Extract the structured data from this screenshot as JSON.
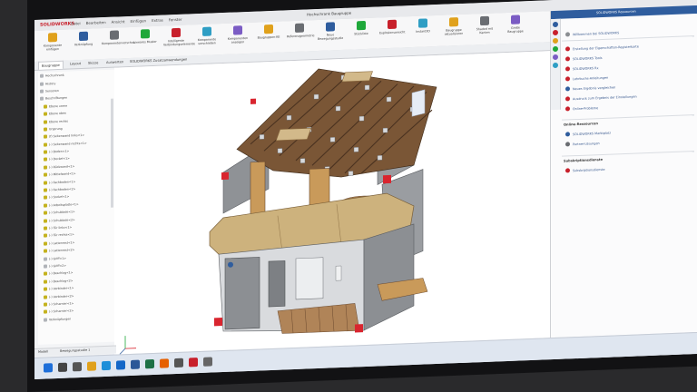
{
  "app": {
    "name": "SOLIDWORKS"
  },
  "menu": [
    "Datei",
    "Bearbeiten",
    "Ansicht",
    "Einfügen",
    "Extras",
    "Fenster"
  ],
  "doc_title": "Hochschrank Baugruppe",
  "ribbon_buttons": [
    "Komponente einfügen",
    "Verknüpfung",
    "Komponentenvorschau",
    "Lineares Muster",
    "Intelligente Verbindungselemente",
    "Komponente verschieben",
    "Komponenten anzeigen",
    "Baugruppen-KE",
    "Referenzgeometrie",
    "Neue Bewegungsstudie",
    "Stückliste",
    "Explosionsansicht",
    "Instant3D",
    "Baugruppe aktualisieren",
    "Shaded mit Kanten",
    "Große Baugruppe"
  ],
  "tabs": [
    "Baugruppe",
    "Layout",
    "Skizze",
    "Auswerten",
    "SOLIDWORKS Zusatzanwendungen"
  ],
  "active_tab_index": 0,
  "tree": {
    "rows": [
      {
        "label": "Hochschrank",
        "grey": true
      },
      {
        "label": "History",
        "grey": true
      },
      {
        "label": "Sensoren",
        "grey": true
      },
      {
        "label": "Beschriftungen",
        "grey": true
      },
      {
        "label": "Ebene vorne",
        "grey": false
      },
      {
        "label": "Ebene oben",
        "grey": false
      },
      {
        "label": "Ebene rechts",
        "grey": false
      },
      {
        "label": "Ursprung",
        "grey": false
      },
      {
        "label": "(f) Seitenwand links<1>",
        "grey": false
      },
      {
        "label": "(-) Seitenwand rechts<1>",
        "grey": false
      },
      {
        "label": "(-) Boden<1>",
        "grey": false
      },
      {
        "label": "(-) Deckel<1>",
        "grey": false
      },
      {
        "label": "(-) Rückwand<1>",
        "grey": false
      },
      {
        "label": "(-) Mittelwand<1>",
        "grey": false
      },
      {
        "label": "(-) Fachboden<1>",
        "grey": false
      },
      {
        "label": "(-) Fachboden<2>",
        "grey": false
      },
      {
        "label": "(-) Sockel<1>",
        "grey": false
      },
      {
        "label": "(-) Arbeitsplatte<1>",
        "grey": false
      },
      {
        "label": "(-) Schublade<1>",
        "grey": false
      },
      {
        "label": "(-) Schublade<2>",
        "grey": false
      },
      {
        "label": "(-) Tür links<1>",
        "grey": false
      },
      {
        "label": "(-) Tür rechts<1>",
        "grey": false
      },
      {
        "label": "(-) Lattenrost<1>",
        "grey": false
      },
      {
        "label": "(-) Lattenrost<2>",
        "grey": false
      },
      {
        "label": "(-) Griff<1>",
        "grey": true
      },
      {
        "label": "(-) Griff<2>",
        "grey": true
      },
      {
        "label": "(-) Beschlag<1>",
        "grey": false
      },
      {
        "label": "(-) Beschlag<2>",
        "grey": false
      },
      {
        "label": "(-) Verbinder<1>",
        "grey": false
      },
      {
        "label": "(-) Verbinder<2>",
        "grey": false
      },
      {
        "label": "(-) Scharnier<1>",
        "grey": false
      },
      {
        "label": "(-) Scharnier<2>",
        "grey": false
      },
      {
        "label": "Verknüpfungen",
        "grey": true
      }
    ]
  },
  "status": {
    "tab1": "Modell",
    "tab2": "Bewegungsstudie 1"
  },
  "taskpane": {
    "header": "SOLIDWORKS Ressourcen",
    "welcome": "Willkommen bei SOLIDWORKS",
    "section1_items": [
      "Erstellung der Eigenschaften-Registerkarte",
      "SOLIDWORKS Tools",
      "SOLIDWORKS Rx",
      "Lehrbuchs-Anleitungen",
      "Neues Ergebnis vergleichen",
      "Ausdruck zum Ergebnis der Einstellungen",
      "Online-Probleme"
    ],
    "section2_title": "Online-Ressourcen",
    "section2_items": [
      "SOLIDWORKS Marktplatz",
      "Partner-Lösungen"
    ],
    "section3_title": "Subskriptionsdienste",
    "section3_items": [
      "Subskriptionsdienste"
    ]
  },
  "colors": {
    "brand": "#c8202b",
    "task_header": "#2f5d9e",
    "link": "#3a5a8f",
    "wood_dark": "#6b4a2f",
    "wood_light": "#d2b98a",
    "panel_grey": "#8c8f93",
    "accent_red": "#d9252f"
  },
  "icons": [
    "windows-start-icon",
    "search-icon",
    "task-view-icon",
    "file-explorer-icon",
    "edge-icon",
    "outlook-icon",
    "word-icon",
    "excel-icon",
    "firefox-icon",
    "store-icon",
    "solidworks-icon",
    "settings-icon"
  ]
}
